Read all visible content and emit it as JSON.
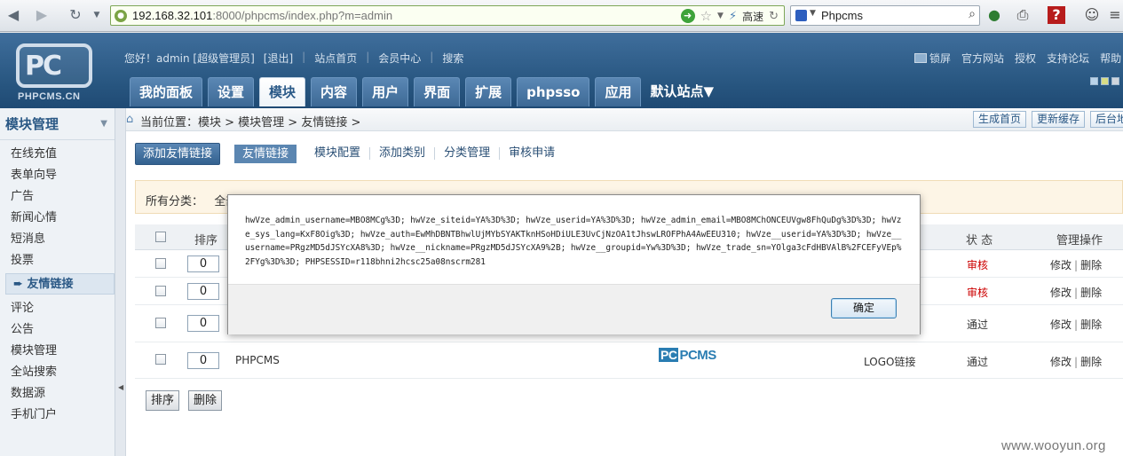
{
  "browser": {
    "url_host": "192.168.32.101",
    "url_path": ":8000/phpcms/index.php?m=admin",
    "speed_label": "高速",
    "search_value": "Phpcms"
  },
  "header": {
    "logo_text": "PC",
    "logo_sub": "PHPCMS.CN",
    "greeting": "您好！admin [超级管理员]",
    "logout": "[退出]",
    "links": [
      "站点首页",
      "会员中心",
      "搜索"
    ],
    "right_links": [
      "锁屏",
      "官方网站",
      "授权",
      "支持论坛",
      "帮助"
    ],
    "tabs": [
      "我的面板",
      "设置",
      "模块",
      "内容",
      "用户",
      "界面",
      "扩展",
      "phpsso",
      "应用"
    ],
    "active_tab": "模块",
    "site_select": "默认站点"
  },
  "sidebar": {
    "title": "模块管理",
    "items": [
      "在线充值",
      "表单向导",
      "广告",
      "新闻心情",
      "短消息",
      "投票",
      "友情链接",
      "评论",
      "公告",
      "模块管理",
      "全站搜索",
      "数据源",
      "手机门户"
    ],
    "active_item": "友情链接"
  },
  "breadcrumb": {
    "text": "当前位置：模块 > 模块管理 > 友情链接 >",
    "buttons": [
      "生成首页",
      "更新缓存",
      "后台地图"
    ]
  },
  "subnav": {
    "add_button": "添加友情链接",
    "current": "友情链接",
    "links": [
      "模块配置",
      "添加类别",
      "分类管理",
      "审核申请"
    ]
  },
  "category_bar": {
    "label": "所有分类：",
    "value": "全部"
  },
  "table": {
    "headers": {
      "order": "排序",
      "status": "状 态",
      "actions": "管理操作"
    },
    "rows": [
      {
        "order": "0",
        "name": "",
        "type": "",
        "status": "审核",
        "pending": true
      },
      {
        "order": "0",
        "name": "",
        "type": "",
        "status": "审核",
        "pending": true
      },
      {
        "order": "0",
        "name": "",
        "type": "",
        "status": "通过",
        "pending": false
      },
      {
        "order": "0",
        "name": "PHPCMS",
        "type": "LOGO链接",
        "status": "通过",
        "pending": false
      }
    ],
    "edit_label": "修改",
    "delete_label": "删除",
    "logo_image_text": "PCMS",
    "logo_image_box": "PC"
  },
  "table_actions": {
    "sort": "排序",
    "delete": "删除"
  },
  "dialog": {
    "message": "hwVze_admin_username=MBO8MCg%3D; hwVze_siteid=YA%3D%3D; hwVze_userid=YA%3D%3D; hwVze_admin_email=MBO8MChONCEUVgw8FhQuDg%3D%3D; hwVze_sys_lang=KxF8Oig%3D; hwVze_auth=EwMhDBNTBhwlUjMYbSYAKTknHSoHDiULE3UvCjNzOA1tJhswLROFPhA4AwEEU310; hwVze__userid=YA%3D%3D; hwVze__username=PRgzMD5dJSYcXA8%3D; hwVze__nickname=PRgzMD5dJSYcXA9%2B; hwVze__groupid=Yw%3D%3D; hwVze_trade_sn=YOlga3cFdHBVAlB%2FCEFyVEp%2FYg%3D%3D; PHPSESSID=r118bhni2hcsc25a08nscrm281",
    "ok_label": "确定"
  },
  "watermark": "www.wooyun.org"
}
